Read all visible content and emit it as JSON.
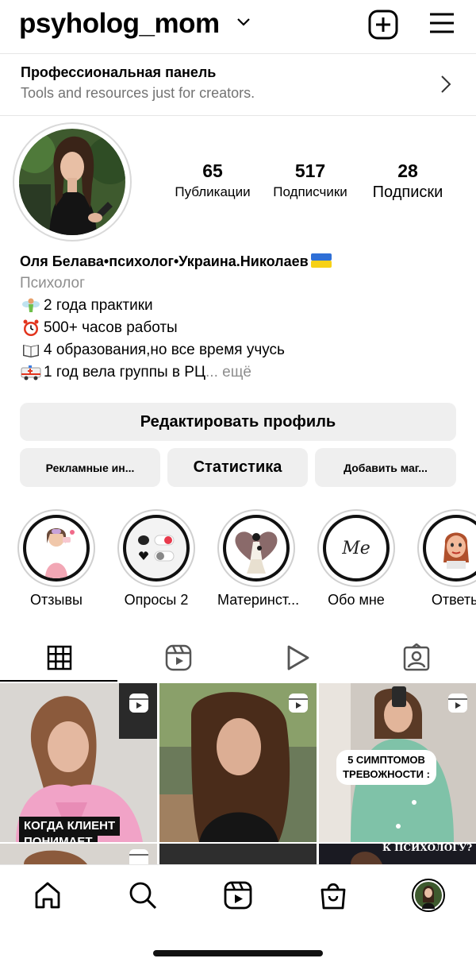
{
  "header": {
    "username": "psyholog_mom"
  },
  "pro_panel": {
    "title": "Профессиональная панель",
    "subtitle": "Tools and resources just for creators."
  },
  "stats": {
    "posts": {
      "value": "65",
      "label": "Публикации"
    },
    "followers": {
      "value": "517",
      "label": "Подписчики"
    },
    "following": {
      "value": "28",
      "label": "Подписки"
    }
  },
  "bio": {
    "name": "Оля Белава•психолог•Украина.Николаев",
    "category": "Психолог",
    "lines": [
      {
        "icon": "fairy-emoji",
        "text": "2 года практики"
      },
      {
        "icon": "alarm-clock-emoji",
        "text": "500+ часов работы"
      },
      {
        "icon": "open-book-emoji",
        "text": "4 образования,но все время учусь"
      },
      {
        "icon": "ambulance-emoji",
        "text": "1 год вела группы в РЦ",
        "more": "... ещё"
      }
    ]
  },
  "buttons": {
    "edit_profile": "Редактировать профиль",
    "ads": "Рекламные ин...",
    "statistics": "Статистика",
    "add_shop": "Добавить маг..."
  },
  "highlights": [
    {
      "label": "Отзывы"
    },
    {
      "label": "Опросы 2"
    },
    {
      "label": "Материнст..."
    },
    {
      "label": "Обо мне",
      "cover_text": "Me"
    },
    {
      "label": "Ответы"
    }
  ],
  "grid": {
    "captions": {
      "post1": [
        "КОГДА КЛИЕНТ",
        "ПОНИМАЕТ"
      ],
      "post3": [
        "5 СИМПТОМОВ",
        "ТРЕВОЖНОСТИ :"
      ],
      "post6": "К ПСИХОЛОГУ?"
    }
  },
  "colors": {
    "button_bg": "#efefef",
    "secondary_text": "#737373",
    "divider": "#e6e6e6"
  }
}
